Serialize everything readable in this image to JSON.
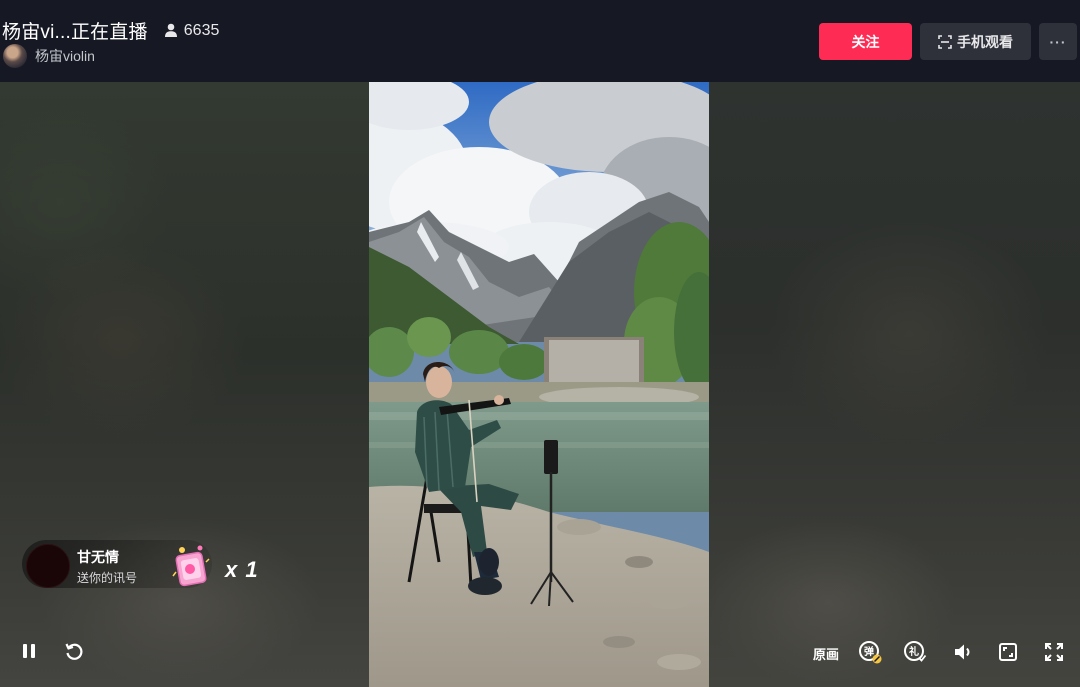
{
  "header": {
    "title": "杨宙vi...正在直播",
    "viewer_count": "6635",
    "host_name": "杨宙violin"
  },
  "actions": {
    "follow_label": "关注",
    "phone_watch_label": "手机观看",
    "more_label": "···"
  },
  "gift_notice": {
    "user": "甘无情",
    "message": "送你的讯号",
    "count": "x 1"
  },
  "controls": {
    "quality_label": "原画",
    "left": [
      "pause-icon",
      "refresh-icon"
    ],
    "right": [
      "danmaku-icon",
      "gift-effect-icon",
      "volume-icon",
      "web-fullscreen-icon",
      "fullscreen-icon"
    ]
  },
  "colors": {
    "background": "#161823",
    "follow_button": "#fe2c55",
    "secondary_button": "#2e303a"
  }
}
